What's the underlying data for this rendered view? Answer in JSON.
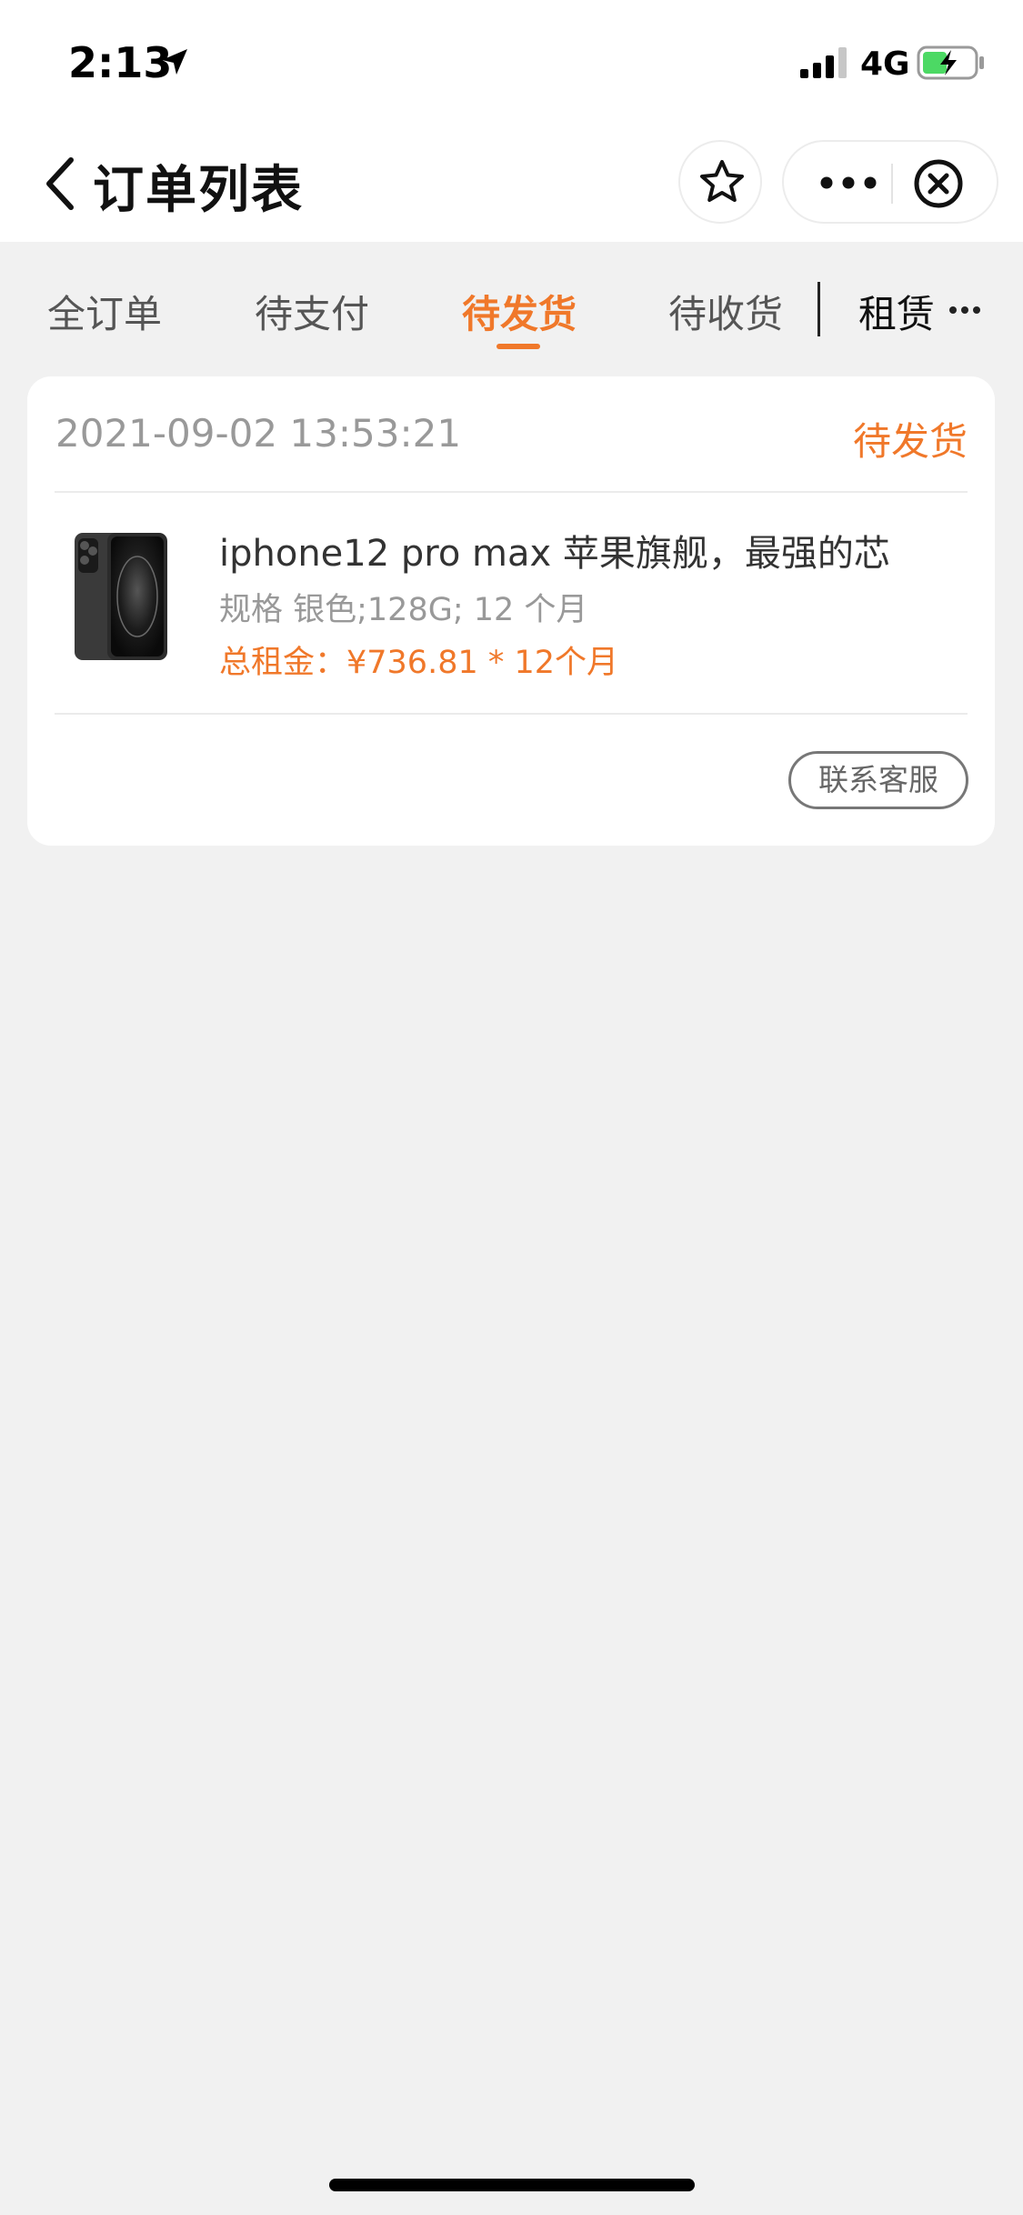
{
  "status_bar": {
    "time": "2:13",
    "network": "4G",
    "icons": [
      "location-arrow-icon",
      "signal-icon",
      "battery-charging-icon"
    ]
  },
  "nav": {
    "title": "订单列表",
    "icons": [
      "back-chevron-icon",
      "star-icon",
      "more-dots-icon",
      "close-circle-icon"
    ]
  },
  "tabs": [
    {
      "label": "全订单",
      "active": false
    },
    {
      "label": "待支付",
      "active": false
    },
    {
      "label": "待发货",
      "active": true
    },
    {
      "label": "待收货",
      "active": false
    },
    {
      "label": "租赁",
      "active": false
    }
  ],
  "tab_overflow_icon": "more-dots-icon",
  "orders": [
    {
      "time": "2021-09-02 13:53:21",
      "status": "待发货",
      "product": {
        "name": "iphone12 pro max 苹果旗舰，最强的芯",
        "spec": "规格 银色;128G; 12 个月",
        "rent": "总租金：¥736.81 * 12个月",
        "image_icon": "phone-product-image"
      },
      "action_label": "联系客服"
    }
  ],
  "colors": {
    "accent": "#f0782a",
    "background": "#f1f1f1",
    "card": "#ffffff"
  }
}
